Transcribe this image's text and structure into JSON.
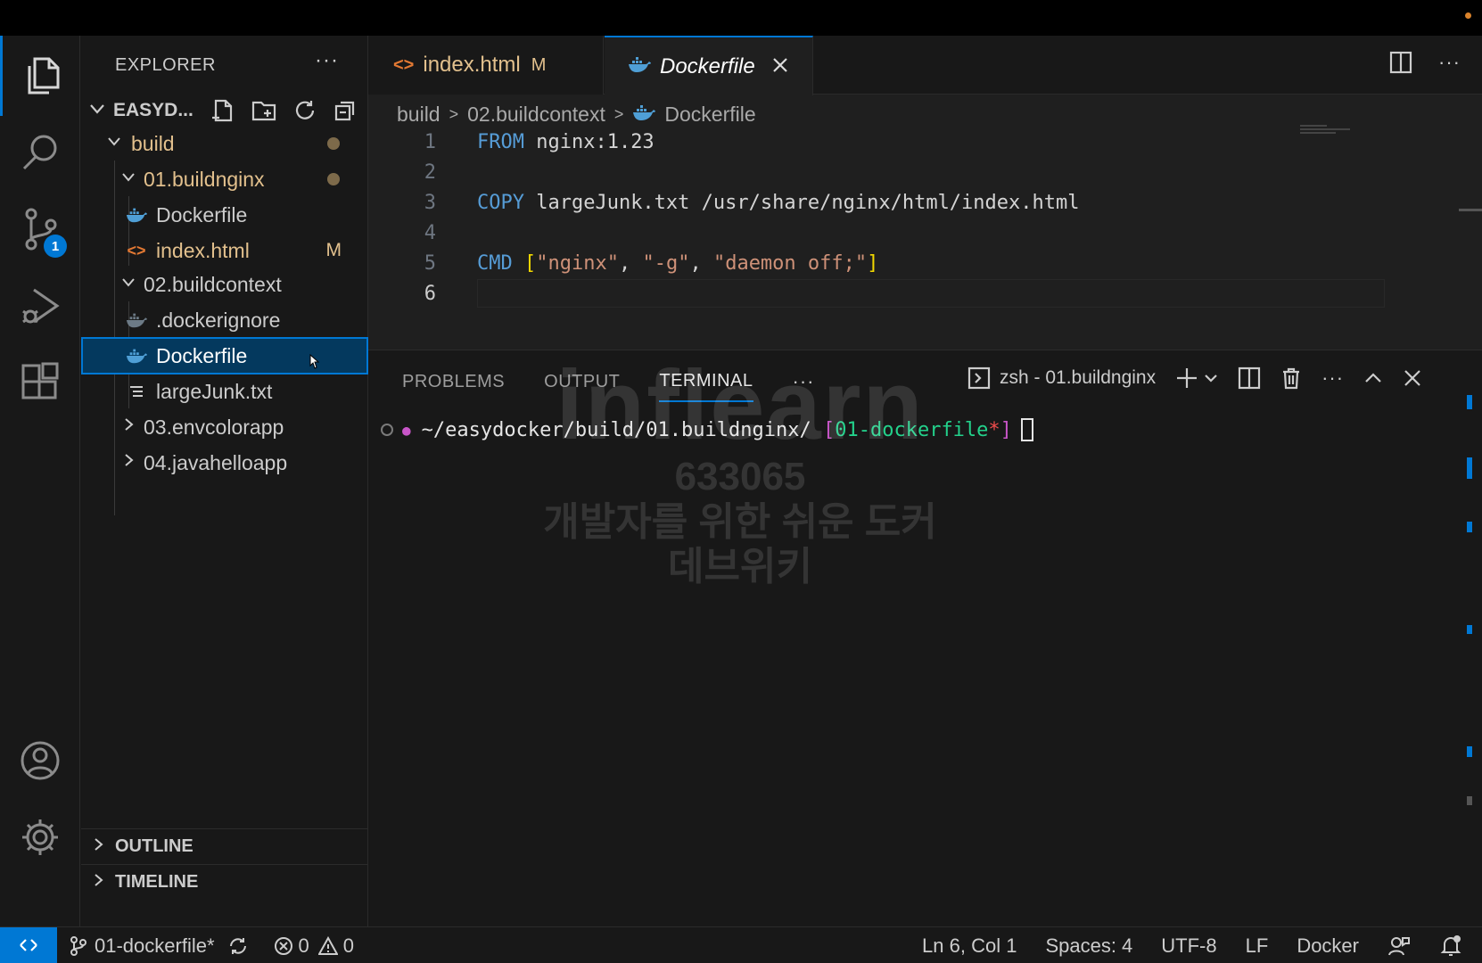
{
  "activity": {
    "scm_badge": "1"
  },
  "sidebar": {
    "title": "EXPLORER",
    "more": "···",
    "workspace": "EASYD...",
    "tree": [
      {
        "label": "build"
      },
      {
        "label": "01.buildnginx"
      },
      {
        "label": "Dockerfile"
      },
      {
        "label": "index.html",
        "decoration": "M"
      },
      {
        "label": "02.buildcontext"
      },
      {
        "label": ".dockerignore"
      },
      {
        "label": "Dockerfile"
      },
      {
        "label": "largeJunk.txt"
      },
      {
        "label": "03.envcolorapp"
      },
      {
        "label": "04.javahelloapp"
      }
    ],
    "outline": "OUTLINE",
    "timeline": "TIMELINE"
  },
  "tabs": [
    {
      "label": "index.html",
      "decoration": "M"
    },
    {
      "label": "Dockerfile"
    }
  ],
  "tab_more": "···",
  "breadcrumb": [
    "build",
    "02.buildcontext",
    "Dockerfile"
  ],
  "code": {
    "line_numbers": [
      "1",
      "2",
      "3",
      "4",
      "5",
      "6"
    ],
    "l1_kw": "FROM",
    "l1_rest": " nginx:1.23",
    "l3_kw": "COPY",
    "l3_rest": " largeJunk.txt /usr/share/nginx/html/index.html",
    "l5_kw": "CMD",
    "l5_sp": " ",
    "l5_ob": "[",
    "l5_s1": "\"nginx\"",
    "l5_c1": ", ",
    "l5_s2": "\"-g\"",
    "l5_c2": ", ",
    "l5_s3": "\"daemon off;\"",
    "l5_cb": "]"
  },
  "panel": {
    "tabs": [
      "PROBLEMS",
      "OUTPUT",
      "TERMINAL"
    ],
    "more": "···",
    "terminal_name": "zsh - 01.buildnginx",
    "actions_more": "···"
  },
  "terminal": {
    "path": "~/easydocker/build/01.buildnginx/ ",
    "open_bracket": "[",
    "branch": "01-dockerfile",
    "dirty": "*",
    "close_bracket": "]"
  },
  "watermark": {
    "logo": "inflearn",
    "id": "633065",
    "course": "개발자를 위한 쉬운 도커",
    "author": "데브위키"
  },
  "status": {
    "branch": "01-dockerfile*",
    "errors": "0",
    "warnings": "0",
    "position": "Ln 6, Col 1",
    "spaces": "Spaces: 4",
    "encoding": "UTF-8",
    "eol": "LF",
    "language": "Docker"
  },
  "colors": {
    "accent": "#0078d4",
    "modified": "#e2c08d",
    "keyword": "#569cd6",
    "string": "#ce9178",
    "branch": "#23d18b"
  }
}
